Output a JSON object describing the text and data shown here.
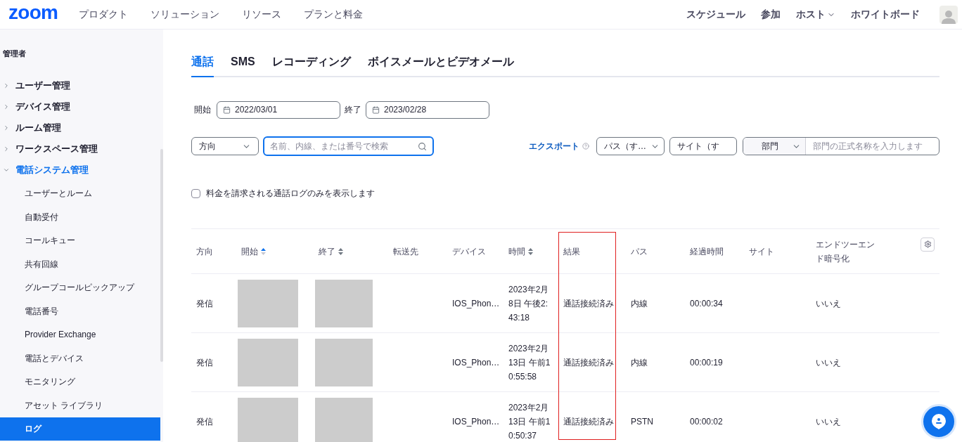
{
  "header": {
    "logo": "zoom",
    "nav": [
      "プロダクト",
      "ソリューション",
      "リソース",
      "プランと料金"
    ],
    "right_nav": [
      {
        "label": "スケジュール",
        "dropdown": false
      },
      {
        "label": "参加",
        "dropdown": false
      },
      {
        "label": "ホスト",
        "dropdown": true
      },
      {
        "label": "ホワイトボード",
        "dropdown": false
      }
    ]
  },
  "sidebar": {
    "title": "管理者",
    "items": [
      {
        "label": "ユーザー管理",
        "expanded": false,
        "selected": false
      },
      {
        "label": "デバイス管理",
        "expanded": false,
        "selected": false
      },
      {
        "label": "ルーム管理",
        "expanded": false,
        "selected": false
      },
      {
        "label": "ワークスペース管理",
        "expanded": false,
        "selected": false
      },
      {
        "label": "電話システム管理",
        "expanded": true,
        "selected": true,
        "children": [
          {
            "label": "ユーザーとルーム",
            "selected": false
          },
          {
            "label": "自動受付",
            "selected": false
          },
          {
            "label": "コールキュー",
            "selected": false
          },
          {
            "label": "共有回線",
            "selected": false
          },
          {
            "label": "グループコールピックアップ",
            "selected": false
          },
          {
            "label": "電話番号",
            "selected": false
          },
          {
            "label": "Provider Exchange",
            "selected": false
          },
          {
            "label": "電話とデバイス",
            "selected": false
          },
          {
            "label": "モニタリング",
            "selected": false
          },
          {
            "label": "アセット ライブラリ",
            "selected": false
          },
          {
            "label": "ログ",
            "selected": true
          }
        ]
      }
    ]
  },
  "tabs": [
    {
      "label": "通話",
      "selected": true
    },
    {
      "label": "SMS",
      "selected": false
    },
    {
      "label": "レコーディング",
      "selected": false
    },
    {
      "label": "ボイスメールとビデオメール",
      "selected": false
    }
  ],
  "date_range": {
    "start_label": "開始",
    "start": "2022/03/01",
    "end_label": "終了",
    "end": "2023/02/28"
  },
  "filters": {
    "direction": "方向",
    "search_placeholder": "名前、内線、または番号で検索",
    "export": "エクスポート",
    "path": "パス（す…",
    "site": "サイト（す",
    "department": "部門",
    "department_placeholder": "部門の正式名称を入力します"
  },
  "billed_only": {
    "label": "料金を請求される通話ログのみを表示します",
    "checked": false
  },
  "table": {
    "columns": [
      {
        "label": "方向"
      },
      {
        "label": "開始",
        "sortable": true,
        "sorted": true
      },
      {
        "label": "終了",
        "sortable": true,
        "sorted": false
      },
      {
        "label": "転送先"
      },
      {
        "label": "デバイス"
      },
      {
        "label": "時間",
        "sortable": true,
        "sorted": false
      },
      {
        "label": "結果",
        "highlighted": true
      },
      {
        "label": "パス"
      },
      {
        "label": "経過時間"
      },
      {
        "label": "サイト"
      },
      {
        "label": "エンドツーエンド暗号化"
      }
    ],
    "rows": [
      [
        "発信",
        null,
        null,
        "",
        "IOS_Phon…",
        "2023年2月8日 午後2:43:18",
        "通話接続済み",
        "内線",
        "00:00:34",
        "",
        "いいえ"
      ],
      [
        "発信",
        null,
        null,
        "",
        "IOS_Phon…",
        "2023年2月13日 午前10:55:58",
        "通話接続済み",
        "内線",
        "00:00:19",
        "",
        "いいえ"
      ],
      [
        "発信",
        null,
        null,
        "",
        "IOS_Phon…",
        "2023年2月13日 午前10:50:37",
        "通話接続済み",
        "PSTN",
        "00:00:02",
        "",
        "いいえ"
      ]
    ]
  }
}
